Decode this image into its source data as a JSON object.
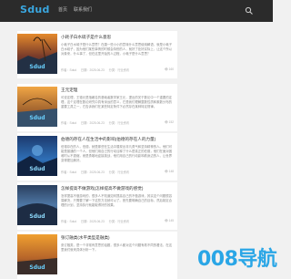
{
  "header": {
    "logo": "Sdud",
    "nav": [
      "首页",
      "联系我们"
    ]
  },
  "articles": [
    {
      "title": "小耗子白水硫子是什么意思",
      "excerpt": "小耗子白水硫子是什么意思？在唐一些小小的意味什么意思使用解语，就是小耗子白水硫子，因为他们某些事情的时候会特别的人，就好了处好实际上，让这个所以对象来，什么事了，但在这里开始的人过程，小耗子是什么意思？",
      "author": "作者：Sdud",
      "date": "日期：2025-06-23",
      "category": "分类：行业资讯",
      "views": "160"
    },
    {
      "title": "王元定理",
      "excerpt": "可说定理，王德元是指著名的基础者数学家王元，提出的关于数论中一个重要的定理，这个定理在数论研究中具有深远的意义，它是我们理解整数性质和素数分布的重要工具之一，它告诉我们在某些特定条件下必然存在某种特定规律。",
      "author": "作者：Sdud",
      "date": "日期：2025-06-23",
      "category": "分类：行业资讯",
      "views": "152"
    },
    {
      "title": "伯德的存在人在生活中的影响(伯德的存在人的力量)",
      "excerpt": "伯德存在的人，伯德，就是那些在生活中展现出非凡勇气和坚持精神的人。他们可能是普通的一个人，但他们用自己的行动诠释了什么是真正的伯德，他们在面对困难时从不退缩，而是勇敢地迎接挑战，他们用自己的行动影响着身边的人，让世界变得更加美好。",
      "author": "作者：Sdud",
      "date": "日期：2025-06-23",
      "category": "分类：行业资讯",
      "views": "148"
    },
    {
      "title": "怎样提高不做游戏(怎样提高不做游戏的感觉)",
      "excerpt": "怎样提高不做游戏的，很多人不知道如何提高自己的不做游戏，其实这个问题很容易解决，只需要了解一下这些方法就可以了。首先要明确自己的目标，然后制定合理的计划，坚持执行就能取得好的效果。",
      "author": "作者：Sdud",
      "date": "日期：2025-06-23",
      "category": "分类：行业资讯",
      "views": "145"
    },
    {
      "title": "张订融类(水平类型是融类)",
      "excerpt": "张订融类，是一个非常有意思的话题，很多人都对这个问题有着不同的看法，在这里我们就来具体分析一下。",
      "author": "作者：Sdud",
      "date": "日期：2025-06-23",
      "category": "分类：行业资讯",
      "views": "141"
    }
  ],
  "watermark": "008导航",
  "colors": {
    "topbar": "#2b2b2b",
    "logo": "#3aa7e0",
    "watermark": "#2aa6e6"
  }
}
